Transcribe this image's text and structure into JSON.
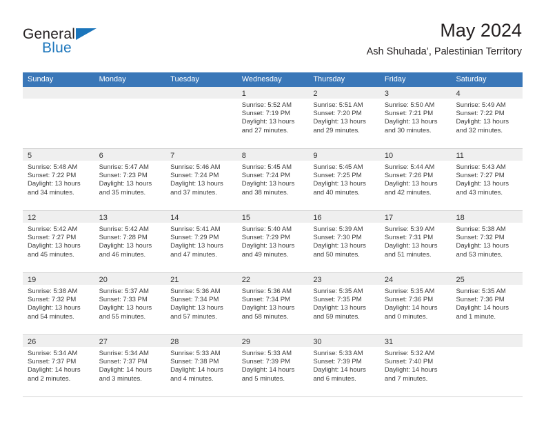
{
  "brand": {
    "word_one": "General",
    "word_two": "Blue",
    "flag_icon": "flag-triangle-icon"
  },
  "header": {
    "title": "May 2024",
    "subtitle": "Ash Shuhada’, Palestinian Territory"
  },
  "calendar": {
    "weekday_headers": [
      "Sunday",
      "Monday",
      "Tuesday",
      "Wednesday",
      "Thursday",
      "Friday",
      "Saturday"
    ],
    "accent_color": "#3a77b8",
    "daynum_band_color": "#efefef",
    "weeks": [
      [
        {
          "day": "",
          "empty": true,
          "sunrise": "",
          "sunset": "",
          "daylight_line1": "",
          "daylight_line2": ""
        },
        {
          "day": "",
          "empty": true,
          "sunrise": "",
          "sunset": "",
          "daylight_line1": "",
          "daylight_line2": ""
        },
        {
          "day": "",
          "empty": true,
          "sunrise": "",
          "sunset": "",
          "daylight_line1": "",
          "daylight_line2": ""
        },
        {
          "day": "1",
          "empty": false,
          "sunrise": "Sunrise: 5:52 AM",
          "sunset": "Sunset: 7:19 PM",
          "daylight_line1": "Daylight: 13 hours",
          "daylight_line2": "and 27 minutes."
        },
        {
          "day": "2",
          "empty": false,
          "sunrise": "Sunrise: 5:51 AM",
          "sunset": "Sunset: 7:20 PM",
          "daylight_line1": "Daylight: 13 hours",
          "daylight_line2": "and 29 minutes."
        },
        {
          "day": "3",
          "empty": false,
          "sunrise": "Sunrise: 5:50 AM",
          "sunset": "Sunset: 7:21 PM",
          "daylight_line1": "Daylight: 13 hours",
          "daylight_line2": "and 30 minutes."
        },
        {
          "day": "4",
          "empty": false,
          "sunrise": "Sunrise: 5:49 AM",
          "sunset": "Sunset: 7:22 PM",
          "daylight_line1": "Daylight: 13 hours",
          "daylight_line2": "and 32 minutes."
        }
      ],
      [
        {
          "day": "5",
          "empty": false,
          "sunrise": "Sunrise: 5:48 AM",
          "sunset": "Sunset: 7:22 PM",
          "daylight_line1": "Daylight: 13 hours",
          "daylight_line2": "and 34 minutes."
        },
        {
          "day": "6",
          "empty": false,
          "sunrise": "Sunrise: 5:47 AM",
          "sunset": "Sunset: 7:23 PM",
          "daylight_line1": "Daylight: 13 hours",
          "daylight_line2": "and 35 minutes."
        },
        {
          "day": "7",
          "empty": false,
          "sunrise": "Sunrise: 5:46 AM",
          "sunset": "Sunset: 7:24 PM",
          "daylight_line1": "Daylight: 13 hours",
          "daylight_line2": "and 37 minutes."
        },
        {
          "day": "8",
          "empty": false,
          "sunrise": "Sunrise: 5:45 AM",
          "sunset": "Sunset: 7:24 PM",
          "daylight_line1": "Daylight: 13 hours",
          "daylight_line2": "and 38 minutes."
        },
        {
          "day": "9",
          "empty": false,
          "sunrise": "Sunrise: 5:45 AM",
          "sunset": "Sunset: 7:25 PM",
          "daylight_line1": "Daylight: 13 hours",
          "daylight_line2": "and 40 minutes."
        },
        {
          "day": "10",
          "empty": false,
          "sunrise": "Sunrise: 5:44 AM",
          "sunset": "Sunset: 7:26 PM",
          "daylight_line1": "Daylight: 13 hours",
          "daylight_line2": "and 42 minutes."
        },
        {
          "day": "11",
          "empty": false,
          "sunrise": "Sunrise: 5:43 AM",
          "sunset": "Sunset: 7:27 PM",
          "daylight_line1": "Daylight: 13 hours",
          "daylight_line2": "and 43 minutes."
        }
      ],
      [
        {
          "day": "12",
          "empty": false,
          "sunrise": "Sunrise: 5:42 AM",
          "sunset": "Sunset: 7:27 PM",
          "daylight_line1": "Daylight: 13 hours",
          "daylight_line2": "and 45 minutes."
        },
        {
          "day": "13",
          "empty": false,
          "sunrise": "Sunrise: 5:42 AM",
          "sunset": "Sunset: 7:28 PM",
          "daylight_line1": "Daylight: 13 hours",
          "daylight_line2": "and 46 minutes."
        },
        {
          "day": "14",
          "empty": false,
          "sunrise": "Sunrise: 5:41 AM",
          "sunset": "Sunset: 7:29 PM",
          "daylight_line1": "Daylight: 13 hours",
          "daylight_line2": "and 47 minutes."
        },
        {
          "day": "15",
          "empty": false,
          "sunrise": "Sunrise: 5:40 AM",
          "sunset": "Sunset: 7:29 PM",
          "daylight_line1": "Daylight: 13 hours",
          "daylight_line2": "and 49 minutes."
        },
        {
          "day": "16",
          "empty": false,
          "sunrise": "Sunrise: 5:39 AM",
          "sunset": "Sunset: 7:30 PM",
          "daylight_line1": "Daylight: 13 hours",
          "daylight_line2": "and 50 minutes."
        },
        {
          "day": "17",
          "empty": false,
          "sunrise": "Sunrise: 5:39 AM",
          "sunset": "Sunset: 7:31 PM",
          "daylight_line1": "Daylight: 13 hours",
          "daylight_line2": "and 51 minutes."
        },
        {
          "day": "18",
          "empty": false,
          "sunrise": "Sunrise: 5:38 AM",
          "sunset": "Sunset: 7:32 PM",
          "daylight_line1": "Daylight: 13 hours",
          "daylight_line2": "and 53 minutes."
        }
      ],
      [
        {
          "day": "19",
          "empty": false,
          "sunrise": "Sunrise: 5:38 AM",
          "sunset": "Sunset: 7:32 PM",
          "daylight_line1": "Daylight: 13 hours",
          "daylight_line2": "and 54 minutes."
        },
        {
          "day": "20",
          "empty": false,
          "sunrise": "Sunrise: 5:37 AM",
          "sunset": "Sunset: 7:33 PM",
          "daylight_line1": "Daylight: 13 hours",
          "daylight_line2": "and 55 minutes."
        },
        {
          "day": "21",
          "empty": false,
          "sunrise": "Sunrise: 5:36 AM",
          "sunset": "Sunset: 7:34 PM",
          "daylight_line1": "Daylight: 13 hours",
          "daylight_line2": "and 57 minutes."
        },
        {
          "day": "22",
          "empty": false,
          "sunrise": "Sunrise: 5:36 AM",
          "sunset": "Sunset: 7:34 PM",
          "daylight_line1": "Daylight: 13 hours",
          "daylight_line2": "and 58 minutes."
        },
        {
          "day": "23",
          "empty": false,
          "sunrise": "Sunrise: 5:35 AM",
          "sunset": "Sunset: 7:35 PM",
          "daylight_line1": "Daylight: 13 hours",
          "daylight_line2": "and 59 minutes."
        },
        {
          "day": "24",
          "empty": false,
          "sunrise": "Sunrise: 5:35 AM",
          "sunset": "Sunset: 7:36 PM",
          "daylight_line1": "Daylight: 14 hours",
          "daylight_line2": "and 0 minutes."
        },
        {
          "day": "25",
          "empty": false,
          "sunrise": "Sunrise: 5:35 AM",
          "sunset": "Sunset: 7:36 PM",
          "daylight_line1": "Daylight: 14 hours",
          "daylight_line2": "and 1 minute."
        }
      ],
      [
        {
          "day": "26",
          "empty": false,
          "sunrise": "Sunrise: 5:34 AM",
          "sunset": "Sunset: 7:37 PM",
          "daylight_line1": "Daylight: 14 hours",
          "daylight_line2": "and 2 minutes."
        },
        {
          "day": "27",
          "empty": false,
          "sunrise": "Sunrise: 5:34 AM",
          "sunset": "Sunset: 7:37 PM",
          "daylight_line1": "Daylight: 14 hours",
          "daylight_line2": "and 3 minutes."
        },
        {
          "day": "28",
          "empty": false,
          "sunrise": "Sunrise: 5:33 AM",
          "sunset": "Sunset: 7:38 PM",
          "daylight_line1": "Daylight: 14 hours",
          "daylight_line2": "and 4 minutes."
        },
        {
          "day": "29",
          "empty": false,
          "sunrise": "Sunrise: 5:33 AM",
          "sunset": "Sunset: 7:39 PM",
          "daylight_line1": "Daylight: 14 hours",
          "daylight_line2": "and 5 minutes."
        },
        {
          "day": "30",
          "empty": false,
          "sunrise": "Sunrise: 5:33 AM",
          "sunset": "Sunset: 7:39 PM",
          "daylight_line1": "Daylight: 14 hours",
          "daylight_line2": "and 6 minutes."
        },
        {
          "day": "31",
          "empty": false,
          "sunrise": "Sunrise: 5:32 AM",
          "sunset": "Sunset: 7:40 PM",
          "daylight_line1": "Daylight: 14 hours",
          "daylight_line2": "and 7 minutes."
        },
        {
          "day": "",
          "empty": true,
          "sunrise": "",
          "sunset": "",
          "daylight_line1": "",
          "daylight_line2": ""
        }
      ]
    ]
  }
}
